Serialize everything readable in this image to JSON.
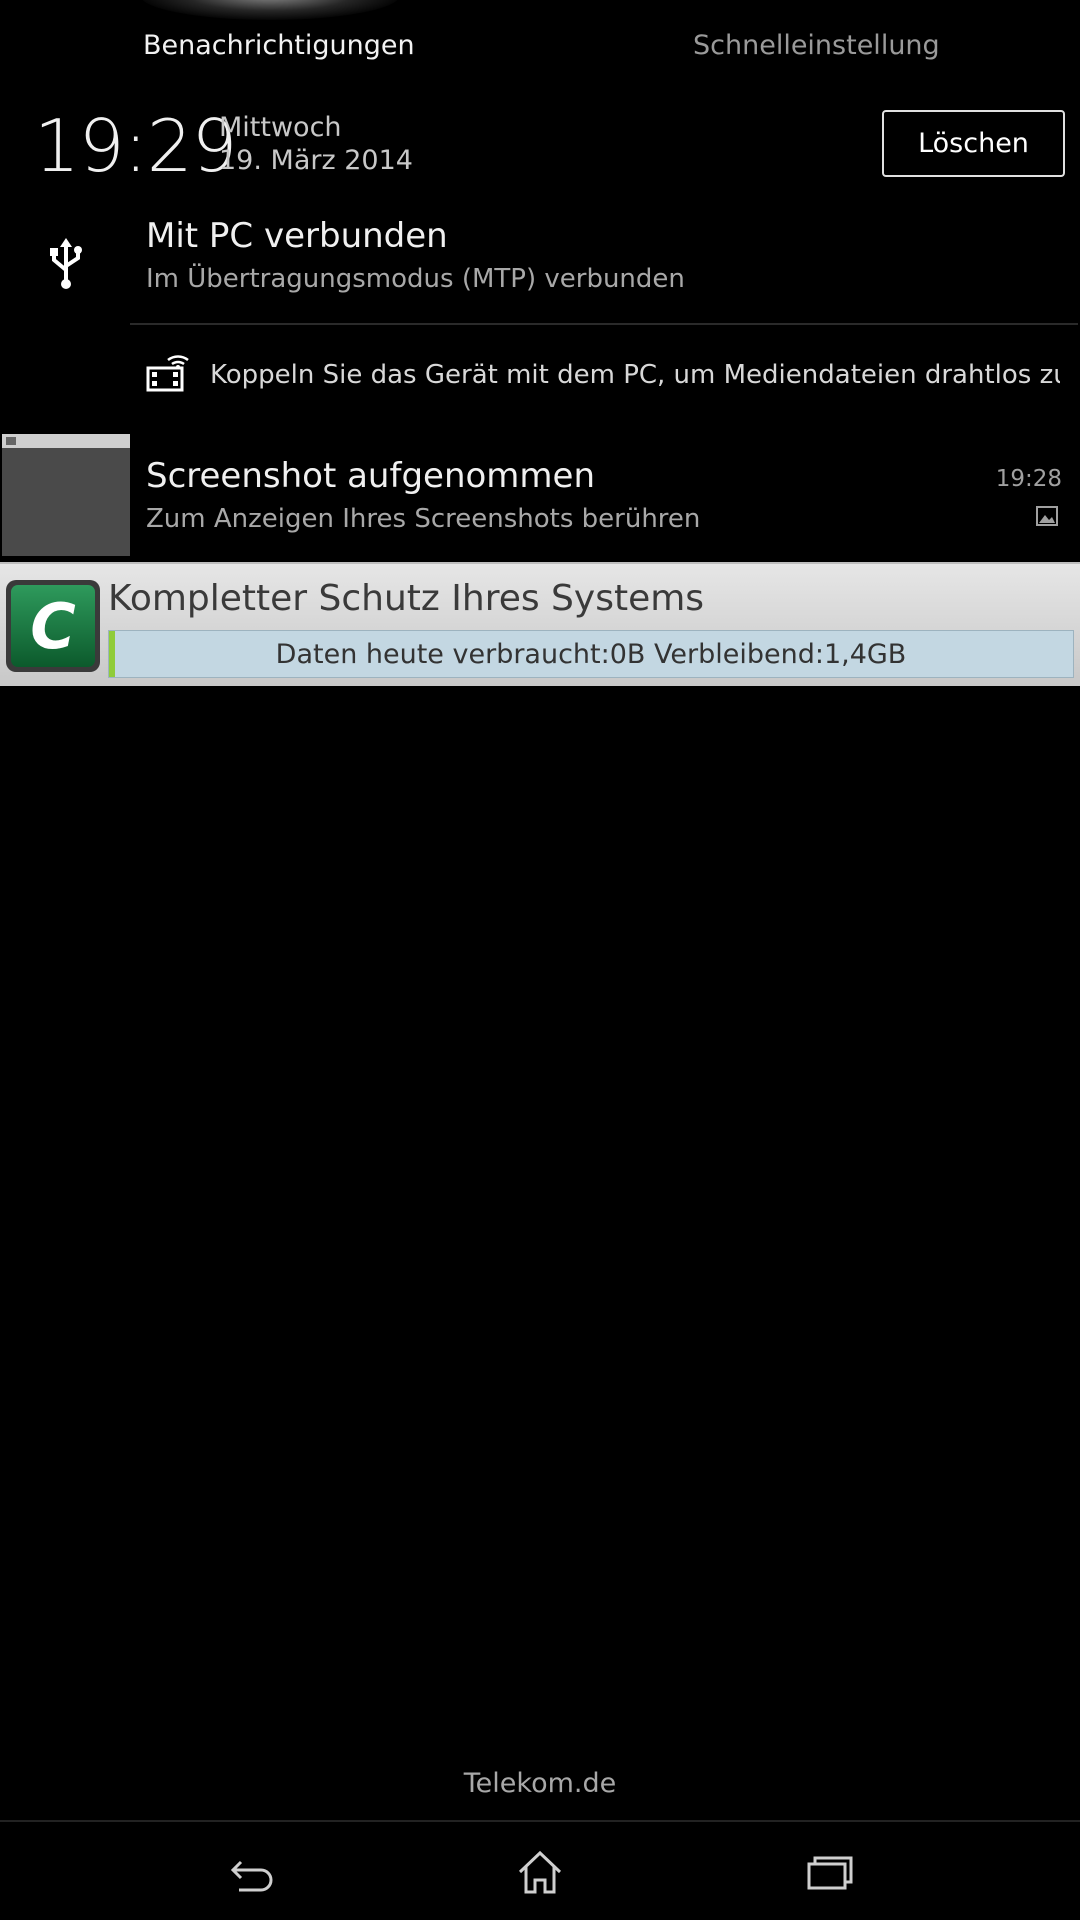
{
  "tabs": {
    "notifications": "Benachrichtigungen",
    "quick_settings": "Schnelleinstellung"
  },
  "header": {
    "time": "19:29",
    "weekday": "Mittwoch",
    "date": "19. März 2014",
    "clear_label": "Löschen"
  },
  "notifications": [
    {
      "icon": "usb-icon",
      "title": "Mit PC verbunden",
      "subtitle": "Im Übertragungsmodus (MTP) verbunden"
    },
    {
      "icon": "wireless-media-icon",
      "text": "Koppeln Sie das Gerät mit dem PC, um Mediendateien drahtlos zu..."
    },
    {
      "icon": "screenshot-thumbnail",
      "title": "Screenshot aufgenommen",
      "subtitle": "Zum Anzeigen Ihres Screenshots berühren",
      "time": "19:28",
      "small_icon": "image-icon"
    },
    {
      "icon": "security-app-icon",
      "app_letter": "C",
      "title": "Kompletter Schutz Ihres Systems",
      "progress_label": "Daten heute verbraucht:0B Verbleibend:1,4GB",
      "progress_fraction": 0.005
    }
  ],
  "carrier": "Telekom.de",
  "navbar": {
    "back": "back-icon",
    "home": "home-icon",
    "recents": "recents-icon"
  },
  "colors": {
    "background": "#000000",
    "text_primary": "#f0f0f0",
    "text_secondary": "#a8a8a8",
    "progress_bg": "#c3d7e2",
    "progress_fill": "#8fcc3a",
    "app_green": "#1f7a44"
  }
}
